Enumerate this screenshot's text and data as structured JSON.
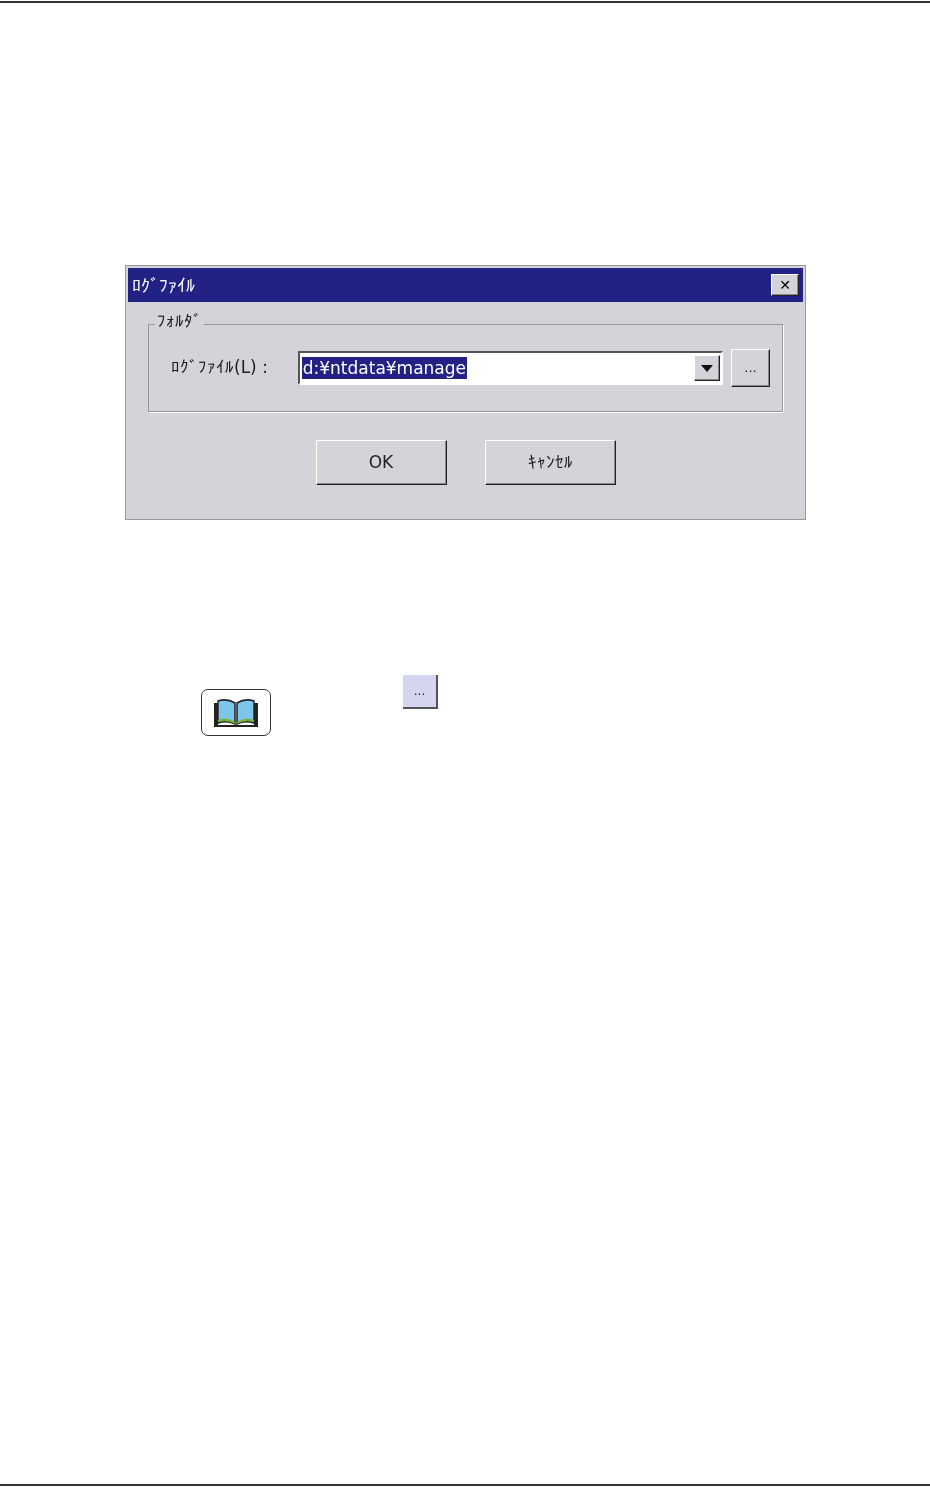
{
  "dialog": {
    "title": "ﾛｸﾞﾌｧｲﾙ",
    "close_label": "✕",
    "group": {
      "label": "ﾌｫﾙﾀﾞ",
      "field_label": "ﾛｸﾞﾌｧｲﾙ(L) :",
      "value": "d:¥ntdata¥manage",
      "value_selected": true,
      "browse_label": "..."
    },
    "buttons": [
      "OK",
      "ｷｬﾝｾﾙ"
    ]
  },
  "legend": {
    "browse_label": "..."
  }
}
